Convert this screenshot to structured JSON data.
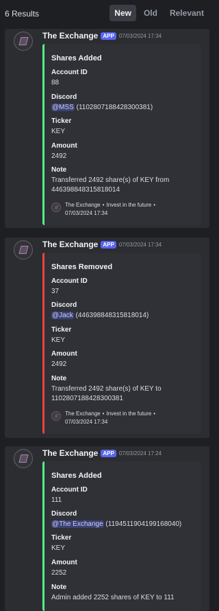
{
  "header": {
    "results": "6 Results",
    "tabs": [
      {
        "label": "New",
        "active": true
      },
      {
        "label": "Old",
        "active": false
      },
      {
        "label": "Relevant",
        "active": false
      }
    ]
  },
  "colors": {
    "added": "#57f287",
    "removed": "#ed4245",
    "app_tag": "#5865f2"
  },
  "messages": [
    {
      "author": "The Exchange",
      "tag": "APP",
      "time": "07/03/2024 17:34",
      "embed": {
        "title": "Shares Added",
        "account_label": "Account ID",
        "account": "88",
        "discord_label": "Discord",
        "mention": "@MSS",
        "discord_id": "(1102807188428300381)",
        "ticker_label": "Ticker",
        "ticker": "KEY",
        "amount_label": "Amount",
        "amount": "2492",
        "note_label": "Note",
        "note": "Transferred 2492 share(s) of KEY from 446398848315818014",
        "footer_name": "The Exchange",
        "footer_tagline": "Invest in the future",
        "footer_time": "07/03/2024 17:34"
      }
    },
    {
      "author": "The Exchange",
      "tag": "APP",
      "time": "07/03/2024 17:34",
      "embed": {
        "title": "Shares Removed",
        "account_label": "Account ID",
        "account": "37",
        "discord_label": "Discord",
        "mention": "@Jack",
        "discord_id": "(446398848315818014)",
        "ticker_label": "Ticker",
        "ticker": "KEY",
        "amount_label": "Amount",
        "amount": "2492",
        "note_label": "Note",
        "note": "Transferred 2492 share(s) of KEY to 1102807188428300381",
        "footer_name": "The Exchange",
        "footer_tagline": "Invest in the future",
        "footer_time": "07/03/2024 17:34"
      }
    },
    {
      "author": "The Exchange",
      "tag": "APP",
      "time": "07/03/2024 17:24",
      "embed": {
        "title": "Shares Added",
        "account_label": "Account ID",
        "account": "111",
        "discord_label": "Discord",
        "mention": "@The Exchange",
        "discord_id": "(1194511904199168040)",
        "ticker_label": "Ticker",
        "ticker": "KEY",
        "amount_label": "Amount",
        "amount": "2252",
        "note_label": "Note",
        "note": "Admin added 2252 shares of KEY to 111"
      }
    }
  ]
}
